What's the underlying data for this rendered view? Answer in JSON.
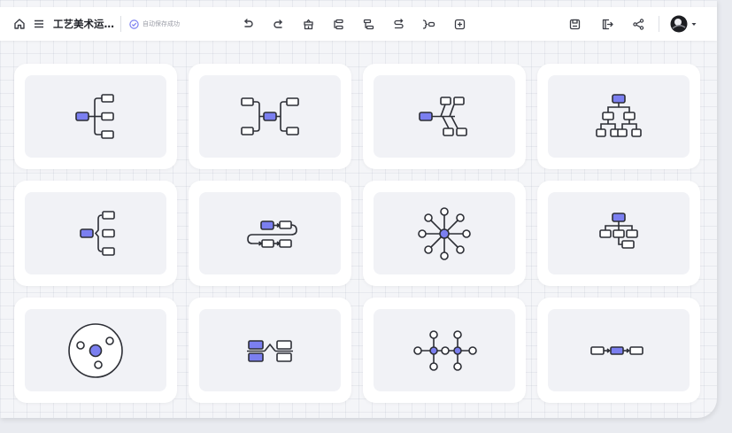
{
  "header": {
    "doc_title": "工艺美术运…",
    "autosave_status": "自动保存成功",
    "icons": {
      "home": "home-icon",
      "menu": "menu-icon",
      "undo": "undo-icon",
      "redo": "redo-icon",
      "format_painter": "format-painter-icon",
      "insert_child": "insert-child-topic-icon",
      "insert_sibling": "insert-sibling-topic-icon",
      "relationship": "relationship-line-icon",
      "summary": "summary-bracket-icon",
      "outline_box": "outline-box-icon",
      "save": "save-icon",
      "export": "export-icon",
      "share": "share-icon",
      "avatar": "avatar",
      "avatar_dropdown": "chevron-down-icon"
    }
  },
  "colors": {
    "accent": "#7b7ff0",
    "stroke": "#2c2e35",
    "card_bg": "#ffffff",
    "card_inner_bg": "#f1f2f6",
    "canvas_bg": "#f4f5f8"
  },
  "layouts": [
    {
      "id": "mind-map-right",
      "icon": "mind-map-right-icon"
    },
    {
      "id": "mind-map-both-sides",
      "icon": "mind-map-both-sides-icon"
    },
    {
      "id": "fishbone",
      "icon": "fishbone-icon"
    },
    {
      "id": "org-chart",
      "icon": "org-chart-icon"
    },
    {
      "id": "bracket",
      "icon": "bracket-icon"
    },
    {
      "id": "timeline-serpentine",
      "icon": "timeline-serpentine-icon"
    },
    {
      "id": "radial",
      "icon": "radial-icon"
    },
    {
      "id": "tree-down",
      "icon": "tree-down-icon"
    },
    {
      "id": "bubble",
      "icon": "bubble-icon"
    },
    {
      "id": "comparison",
      "icon": "comparison-icon"
    },
    {
      "id": "node-chain",
      "icon": "node-chain-icon"
    },
    {
      "id": "linear-flow",
      "icon": "linear-flow-icon"
    }
  ]
}
